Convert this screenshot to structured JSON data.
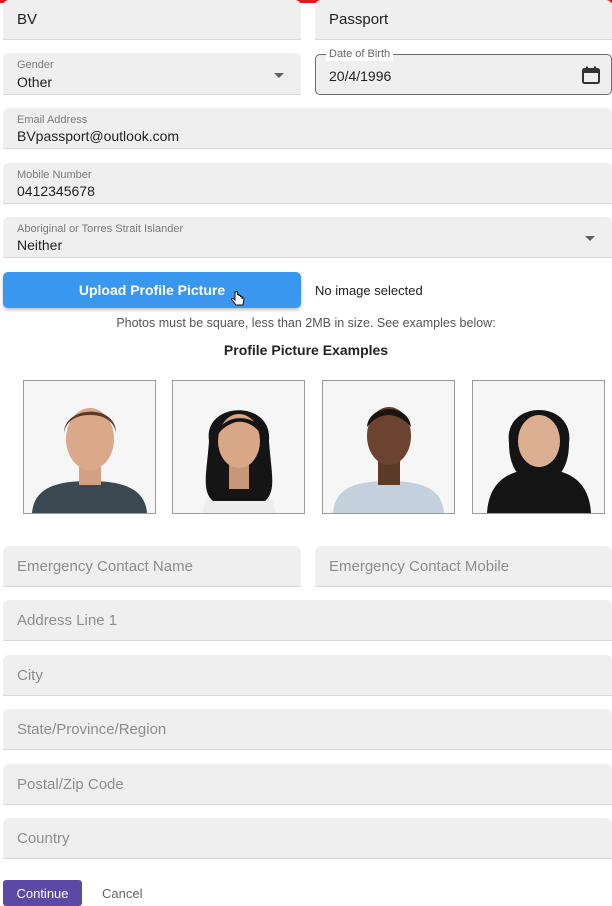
{
  "form": {
    "first_name": "BV",
    "last_name": "Passport",
    "gender": {
      "label": "Gender",
      "value": "Other"
    },
    "dob": {
      "label": "Date of Birth",
      "value": "20/4/1996"
    },
    "email": {
      "label": "Email Address",
      "value": "BVpassport@outlook.com"
    },
    "mobile": {
      "label": "Mobile Number",
      "value": "0412345678"
    },
    "aboriginal": {
      "label": "Aboriginal or Torres Strait Islander",
      "value": "Neither"
    }
  },
  "upload": {
    "button_label": "Upload Profile Picture",
    "status": "No image selected",
    "hint": "Photos must be square, less than 2MB in size. See examples below:",
    "examples_title": "Profile Picture Examples"
  },
  "emergency": {
    "name_placeholder": "Emergency Contact Name",
    "mobile_placeholder": "Emergency Contact Mobile"
  },
  "address": {
    "line1_placeholder": "Address Line 1",
    "city_placeholder": "City",
    "state_placeholder": "State/Province/Region",
    "postal_placeholder": "Postal/Zip Code",
    "country_placeholder": "Country"
  },
  "actions": {
    "continue_label": "Continue",
    "cancel_label": "Cancel"
  },
  "colors": {
    "accent_blue": "#3a97ef",
    "primary_purple": "#5b49a6",
    "top_bar_red": "#e8161b"
  }
}
